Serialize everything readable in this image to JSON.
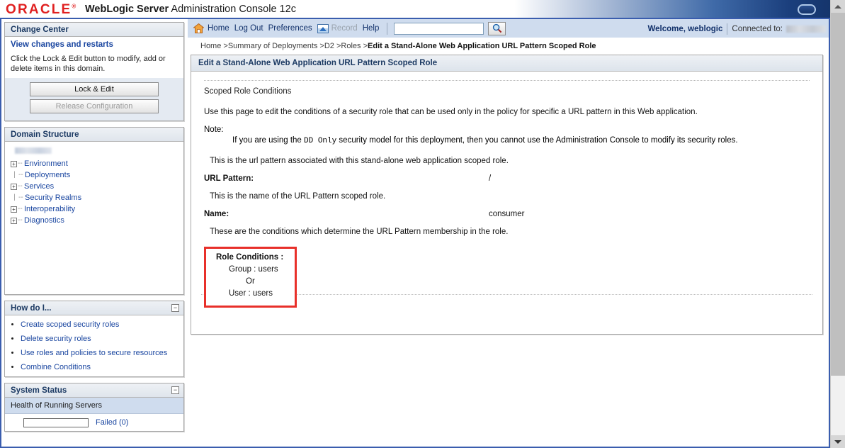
{
  "banner": {
    "logo": "ORACLE",
    "logo_tm": "®",
    "product_bold": "WebLogic Server",
    "product_rest": " Administration Console 12c",
    "window_icon": "rounded-rect-icon"
  },
  "change_center": {
    "title": "Change Center",
    "view_changes_link": "View changes and restarts",
    "help_text": "Click the Lock & Edit button to modify, add or delete items in this domain.",
    "lock_edit_button": "Lock & Edit",
    "release_config_button": "Release Configuration"
  },
  "domain_structure": {
    "title": "Domain Structure",
    "domain_name": "",
    "items": [
      {
        "label": "Environment",
        "expandable": true
      },
      {
        "label": "Deployments",
        "expandable": false
      },
      {
        "label": "Services",
        "expandable": true
      },
      {
        "label": "Security Realms",
        "expandable": false
      },
      {
        "label": "Interoperability",
        "expandable": true
      },
      {
        "label": "Diagnostics",
        "expandable": true
      }
    ]
  },
  "how_do_i": {
    "title": "How do I...",
    "collapse_glyph": "−",
    "items": [
      "Create scoped security roles",
      "Delete security roles",
      "Use roles and policies to secure resources",
      "Combine Conditions"
    ]
  },
  "system_status": {
    "title": "System Status",
    "collapse_glyph": "−",
    "subtitle": "Health of Running Servers",
    "failed_label": "Failed (0)"
  },
  "toolbar": {
    "home": "Home",
    "log_out": "Log Out",
    "preferences": "Preferences",
    "record": "Record",
    "help": "Help",
    "search_value": "",
    "search_placeholder": "",
    "search_button_icon": "magnifier-icon",
    "welcome": "Welcome, weblogic",
    "connected_label": "Connected to:",
    "connected_value": ""
  },
  "breadcrumb": {
    "items": [
      "Home",
      "Summary of Deployments",
      "D2",
      "Roles"
    ],
    "separator": ">",
    "current": "Edit a Stand-Alone Web Application URL Pattern Scoped Role"
  },
  "content": {
    "header": "Edit a Stand-Alone Web Application URL Pattern Scoped Role",
    "section_title": "Scoped Role Conditions",
    "intro": "Use this page to edit the conditions of a security role that can be used only in the policy for specific a URL pattern in this Web application.",
    "note_label": "Note:",
    "note_pre": "If you are using the ",
    "note_mono": "DD  Only",
    "note_post": " security model for this deployment, then you cannot use the Administration Console to modify its security roles.",
    "url_pattern_desc": "This is the url pattern associated with this stand-alone web application scoped role.",
    "url_pattern_label": "URL Pattern:",
    "url_pattern_value": "/",
    "name_desc": "This is the name of the URL Pattern scoped role.",
    "name_label": "Name:",
    "name_value": "consumer",
    "conditions_desc": "These are the conditions which determine the URL Pattern membership in the role.",
    "role_conditions_title": "Role Conditions :",
    "role_conditions": [
      {
        "text": "Group : users",
        "type": "condition"
      },
      {
        "text": "Or",
        "type": "operator"
      },
      {
        "text": "User : users",
        "type": "condition"
      }
    ]
  },
  "colors": {
    "oracle_red": "#e02020",
    "link_blue": "#1a46a0",
    "banner_blue": "#15356c",
    "highlight_red": "#e8302a",
    "panel_head": "#dfe5ec",
    "toolbar_blue": "#cfdcee"
  }
}
